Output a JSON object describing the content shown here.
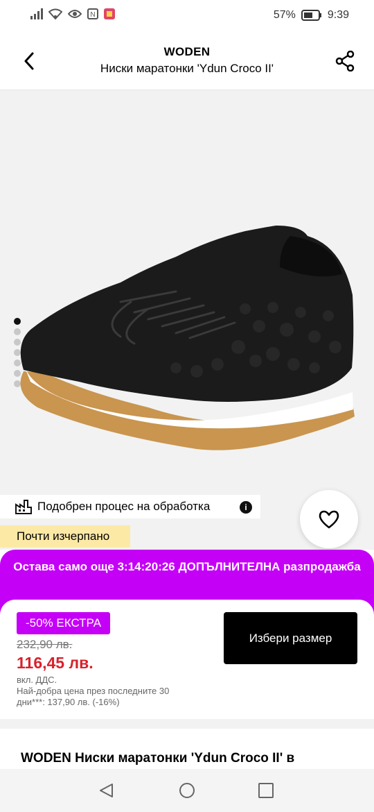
{
  "status_bar": {
    "battery_percent": "57%",
    "time": "9:39"
  },
  "header": {
    "brand": "WODEN",
    "product_name": "Ниски маратонки 'Ydun Croco II'"
  },
  "gallery": {
    "image_count": 7,
    "active_index": 0
  },
  "badges": {
    "process": "Подобрен процес на обработка",
    "low_stock": "Почти изчерпано",
    "info_glyph": "i"
  },
  "sale_banner": {
    "text": "Остава само още 3:14:20:26 ДОПЪЛНИТЕЛНА разпродажба"
  },
  "price": {
    "discount_label": "-50% ЕКСТРА",
    "old_price": "232,90 лв.",
    "new_price": "116,45 лв.",
    "vat_note": "вкл. ДДС.",
    "best_price_note": "Най-добра цена през последните 30 дни***: 137,90 лв. (-16%)"
  },
  "actions": {
    "choose_size": "Избери размер"
  },
  "description": {
    "title": "WODEN Ниски маратонки 'Ydun Croco II' в"
  },
  "colors": {
    "accent_purple": "#c500f7",
    "price_red": "#d8212c",
    "low_stock_yellow": "#fce9a6"
  }
}
